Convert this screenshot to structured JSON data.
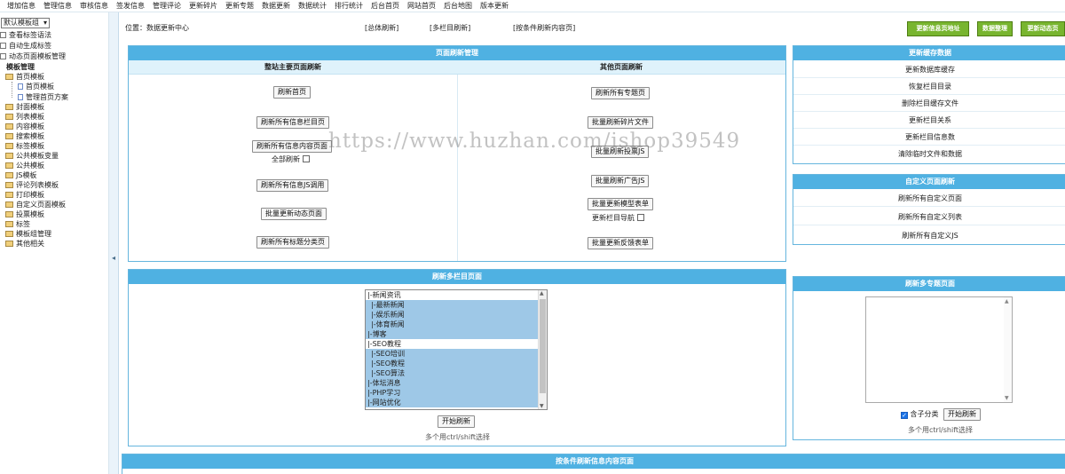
{
  "top_nav": [
    "增加信息",
    "管理信息",
    "审核信息",
    "签发信息",
    "管理评论",
    "更新碎片",
    "更新专题",
    "数据更新",
    "数据统计",
    "排行统计",
    "后台首页",
    "网站首页",
    "后台地图",
    "版本更新"
  ],
  "sidebar": {
    "select_value": "默认模板组",
    "items": [
      "查看标签语法",
      "自动生成标签",
      "动态页面模板管理",
      "模板管理",
      "首页模板",
      "首页模板",
      "管理首页方案",
      "封面模板",
      "列表模板",
      "内容模板",
      "搜索模板",
      "标签模板",
      "公共模板变量",
      "公共模板",
      "JS模板",
      "评论列表模板",
      "打印模板",
      "自定义页面模板",
      "投票模板",
      "标签",
      "模板组管理",
      "其他相关"
    ],
    "collapse_glyph": "◂"
  },
  "location": {
    "label": "位置：数据更新中心"
  },
  "top_links": [
    "[总体刷新]",
    "[多栏目刷新]",
    "[按条件刷新内容页]"
  ],
  "top_buttons": [
    "更新信息页地址",
    "数据整理",
    "更新动态页"
  ],
  "main_panel": {
    "title": "页面刷新管理",
    "left_header": "整站主要页面刷新",
    "right_header": "其他页面刷新",
    "left_buttons": [
      "刷新首页",
      "刷新所有信息栏目页",
      "刷新所有信息内容页面",
      "刷新所有信息JS调用",
      "批量更新动态页面",
      "刷新所有标题分类页"
    ],
    "all_refresh_label": "全部刷新",
    "right_buttons": [
      "刷新所有专题页",
      "批量刷新碎片文件",
      "批量刷新投票JS",
      "批量刷新广告JS",
      "批量更新模型表单",
      "批量更新反馈表单"
    ],
    "nav_update_label": "更新栏目导航"
  },
  "cache_panel": {
    "title": "更新缓存数据",
    "items": [
      "更新数据库缓存",
      "恢复栏目目录",
      "删除栏目缓存文件",
      "更新栏目关系",
      "更新栏目信息数",
      "清除临时文件和数据"
    ]
  },
  "custom_panel": {
    "title": "自定义页面刷新",
    "items": [
      "刷新所有自定义页面",
      "刷新所有自定义列表",
      "刷新所有自定义JS"
    ]
  },
  "multi_col_panel": {
    "title": "刷新多栏目页面",
    "options": [
      {
        "label": "|-新闻资讯",
        "selected": false
      },
      {
        "label": "|-最新新闻",
        "selected": true
      },
      {
        "label": "|-娱乐新闻",
        "selected": true
      },
      {
        "label": "|-体育新闻",
        "selected": true
      },
      {
        "label": "|-博客",
        "selected": true
      },
      {
        "label": "|-SEO教程",
        "selected": false
      },
      {
        "label": "|-SEO培训",
        "selected": true
      },
      {
        "label": "|-SEO教程",
        "selected": true
      },
      {
        "label": "|-SEO算法",
        "selected": true
      },
      {
        "label": "|-体坛消息",
        "selected": true
      },
      {
        "label": "|-PHP学习",
        "selected": true
      },
      {
        "label": "|-网站优化",
        "selected": true
      }
    ],
    "start_button": "开始刷新",
    "hint": "多个用ctrl/shift选择"
  },
  "multi_topic_panel": {
    "title": "刷新多专题页面",
    "include_sub_label": "含子分类",
    "start_button": "开始刷新",
    "hint": "多个用ctrl/shift选择"
  },
  "condition_panel": {
    "title": "按条件刷新信息内容页面"
  },
  "watermark": "https://www.huzhan.com/ishop39549",
  "colors": {
    "panel_header": "#4fb1e2",
    "sub_header": "#dff2fb",
    "green_button": "#78b52f",
    "selected_option": "#9ec8e7"
  }
}
